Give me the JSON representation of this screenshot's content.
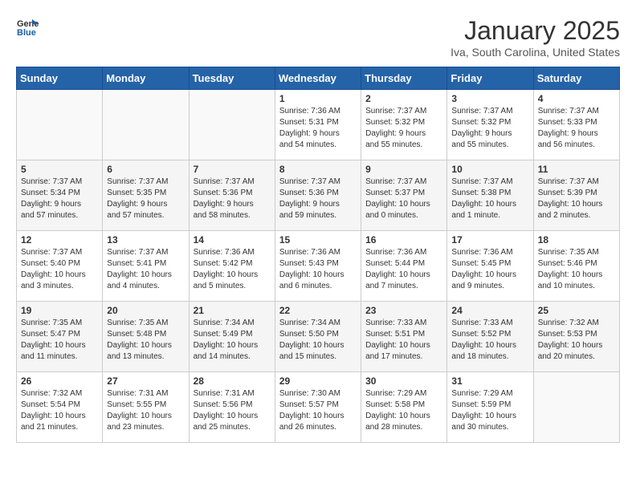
{
  "header": {
    "logo_line1": "General",
    "logo_line2": "Blue",
    "title": "January 2025",
    "subtitle": "Iva, South Carolina, United States"
  },
  "weekdays": [
    "Sunday",
    "Monday",
    "Tuesday",
    "Wednesday",
    "Thursday",
    "Friday",
    "Saturday"
  ],
  "weeks": [
    [
      {
        "num": "",
        "info": ""
      },
      {
        "num": "",
        "info": ""
      },
      {
        "num": "",
        "info": ""
      },
      {
        "num": "1",
        "info": "Sunrise: 7:36 AM\nSunset: 5:31 PM\nDaylight: 9 hours\nand 54 minutes."
      },
      {
        "num": "2",
        "info": "Sunrise: 7:37 AM\nSunset: 5:32 PM\nDaylight: 9 hours\nand 55 minutes."
      },
      {
        "num": "3",
        "info": "Sunrise: 7:37 AM\nSunset: 5:32 PM\nDaylight: 9 hours\nand 55 minutes."
      },
      {
        "num": "4",
        "info": "Sunrise: 7:37 AM\nSunset: 5:33 PM\nDaylight: 9 hours\nand 56 minutes."
      }
    ],
    [
      {
        "num": "5",
        "info": "Sunrise: 7:37 AM\nSunset: 5:34 PM\nDaylight: 9 hours\nand 57 minutes."
      },
      {
        "num": "6",
        "info": "Sunrise: 7:37 AM\nSunset: 5:35 PM\nDaylight: 9 hours\nand 57 minutes."
      },
      {
        "num": "7",
        "info": "Sunrise: 7:37 AM\nSunset: 5:36 PM\nDaylight: 9 hours\nand 58 minutes."
      },
      {
        "num": "8",
        "info": "Sunrise: 7:37 AM\nSunset: 5:36 PM\nDaylight: 9 hours\nand 59 minutes."
      },
      {
        "num": "9",
        "info": "Sunrise: 7:37 AM\nSunset: 5:37 PM\nDaylight: 10 hours\nand 0 minutes."
      },
      {
        "num": "10",
        "info": "Sunrise: 7:37 AM\nSunset: 5:38 PM\nDaylight: 10 hours\nand 1 minute."
      },
      {
        "num": "11",
        "info": "Sunrise: 7:37 AM\nSunset: 5:39 PM\nDaylight: 10 hours\nand 2 minutes."
      }
    ],
    [
      {
        "num": "12",
        "info": "Sunrise: 7:37 AM\nSunset: 5:40 PM\nDaylight: 10 hours\nand 3 minutes."
      },
      {
        "num": "13",
        "info": "Sunrise: 7:37 AM\nSunset: 5:41 PM\nDaylight: 10 hours\nand 4 minutes."
      },
      {
        "num": "14",
        "info": "Sunrise: 7:36 AM\nSunset: 5:42 PM\nDaylight: 10 hours\nand 5 minutes."
      },
      {
        "num": "15",
        "info": "Sunrise: 7:36 AM\nSunset: 5:43 PM\nDaylight: 10 hours\nand 6 minutes."
      },
      {
        "num": "16",
        "info": "Sunrise: 7:36 AM\nSunset: 5:44 PM\nDaylight: 10 hours\nand 7 minutes."
      },
      {
        "num": "17",
        "info": "Sunrise: 7:36 AM\nSunset: 5:45 PM\nDaylight: 10 hours\nand 9 minutes."
      },
      {
        "num": "18",
        "info": "Sunrise: 7:35 AM\nSunset: 5:46 PM\nDaylight: 10 hours\nand 10 minutes."
      }
    ],
    [
      {
        "num": "19",
        "info": "Sunrise: 7:35 AM\nSunset: 5:47 PM\nDaylight: 10 hours\nand 11 minutes."
      },
      {
        "num": "20",
        "info": "Sunrise: 7:35 AM\nSunset: 5:48 PM\nDaylight: 10 hours\nand 13 minutes."
      },
      {
        "num": "21",
        "info": "Sunrise: 7:34 AM\nSunset: 5:49 PM\nDaylight: 10 hours\nand 14 minutes."
      },
      {
        "num": "22",
        "info": "Sunrise: 7:34 AM\nSunset: 5:50 PM\nDaylight: 10 hours\nand 15 minutes."
      },
      {
        "num": "23",
        "info": "Sunrise: 7:33 AM\nSunset: 5:51 PM\nDaylight: 10 hours\nand 17 minutes."
      },
      {
        "num": "24",
        "info": "Sunrise: 7:33 AM\nSunset: 5:52 PM\nDaylight: 10 hours\nand 18 minutes."
      },
      {
        "num": "25",
        "info": "Sunrise: 7:32 AM\nSunset: 5:53 PM\nDaylight: 10 hours\nand 20 minutes."
      }
    ],
    [
      {
        "num": "26",
        "info": "Sunrise: 7:32 AM\nSunset: 5:54 PM\nDaylight: 10 hours\nand 21 minutes."
      },
      {
        "num": "27",
        "info": "Sunrise: 7:31 AM\nSunset: 5:55 PM\nDaylight: 10 hours\nand 23 minutes."
      },
      {
        "num": "28",
        "info": "Sunrise: 7:31 AM\nSunset: 5:56 PM\nDaylight: 10 hours\nand 25 minutes."
      },
      {
        "num": "29",
        "info": "Sunrise: 7:30 AM\nSunset: 5:57 PM\nDaylight: 10 hours\nand 26 minutes."
      },
      {
        "num": "30",
        "info": "Sunrise: 7:29 AM\nSunset: 5:58 PM\nDaylight: 10 hours\nand 28 minutes."
      },
      {
        "num": "31",
        "info": "Sunrise: 7:29 AM\nSunset: 5:59 PM\nDaylight: 10 hours\nand 30 minutes."
      },
      {
        "num": "",
        "info": ""
      }
    ]
  ]
}
